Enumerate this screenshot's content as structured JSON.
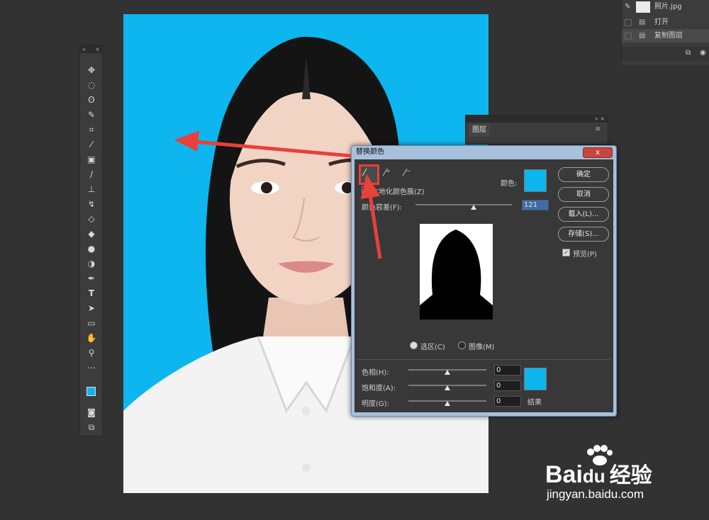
{
  "history_panel": {
    "snapshot_name": "照片.jpg",
    "items": [
      "打开",
      "复制图层"
    ]
  },
  "layers_panel": {
    "tab_label": "图层"
  },
  "dialog": {
    "title": "替换颜色",
    "close_label": "x",
    "localized_clusters_label": "本地化颜色簇(Z)",
    "color_label": "颜色:",
    "fuzziness_label": "颜色容差(F):",
    "fuzziness_value": "121",
    "fuzziness_fraction": 0.6,
    "buttons": {
      "ok": "确定",
      "cancel": "取消",
      "load": "载入(L)...",
      "save": "存储(S)..."
    },
    "preview_label": "预览(P)",
    "preview_checked": true,
    "radio_selection": "选区(C)",
    "radio_image": "图像(M)",
    "selected_radio": "selection",
    "hue_label": "色相(H):",
    "hue_value": "0",
    "saturation_label": "饱和度(A):",
    "saturation_value": "0",
    "lightness_label": "明度(G):",
    "lightness_value": "0",
    "result_label": "结果",
    "selected_color": "#0db6ef",
    "result_color": "#0db6ef"
  },
  "watermark": {
    "brand_bai": "Bai",
    "brand_du": "du",
    "brand_cn": "经验",
    "url": "jingyan.baidu.com"
  },
  "colors": {
    "photo_background": "#0db6ef",
    "highlight": "#e8403a",
    "canvas_bg": "#323232"
  },
  "toolbar_icons": [
    "move-icon",
    "marquee-icon",
    "lasso-icon",
    "quick-select-icon",
    "crop-icon",
    "eyedropper-icon",
    "frame-icon",
    "brush-icon",
    "stamp-icon",
    "history-brush-icon",
    "eraser-icon",
    "bucket-icon",
    "blur-icon",
    "dodge-icon",
    "pen-icon",
    "type-icon",
    "path-select-icon",
    "rectangle-icon",
    "hand-icon",
    "zoom-icon",
    "more-icon"
  ]
}
